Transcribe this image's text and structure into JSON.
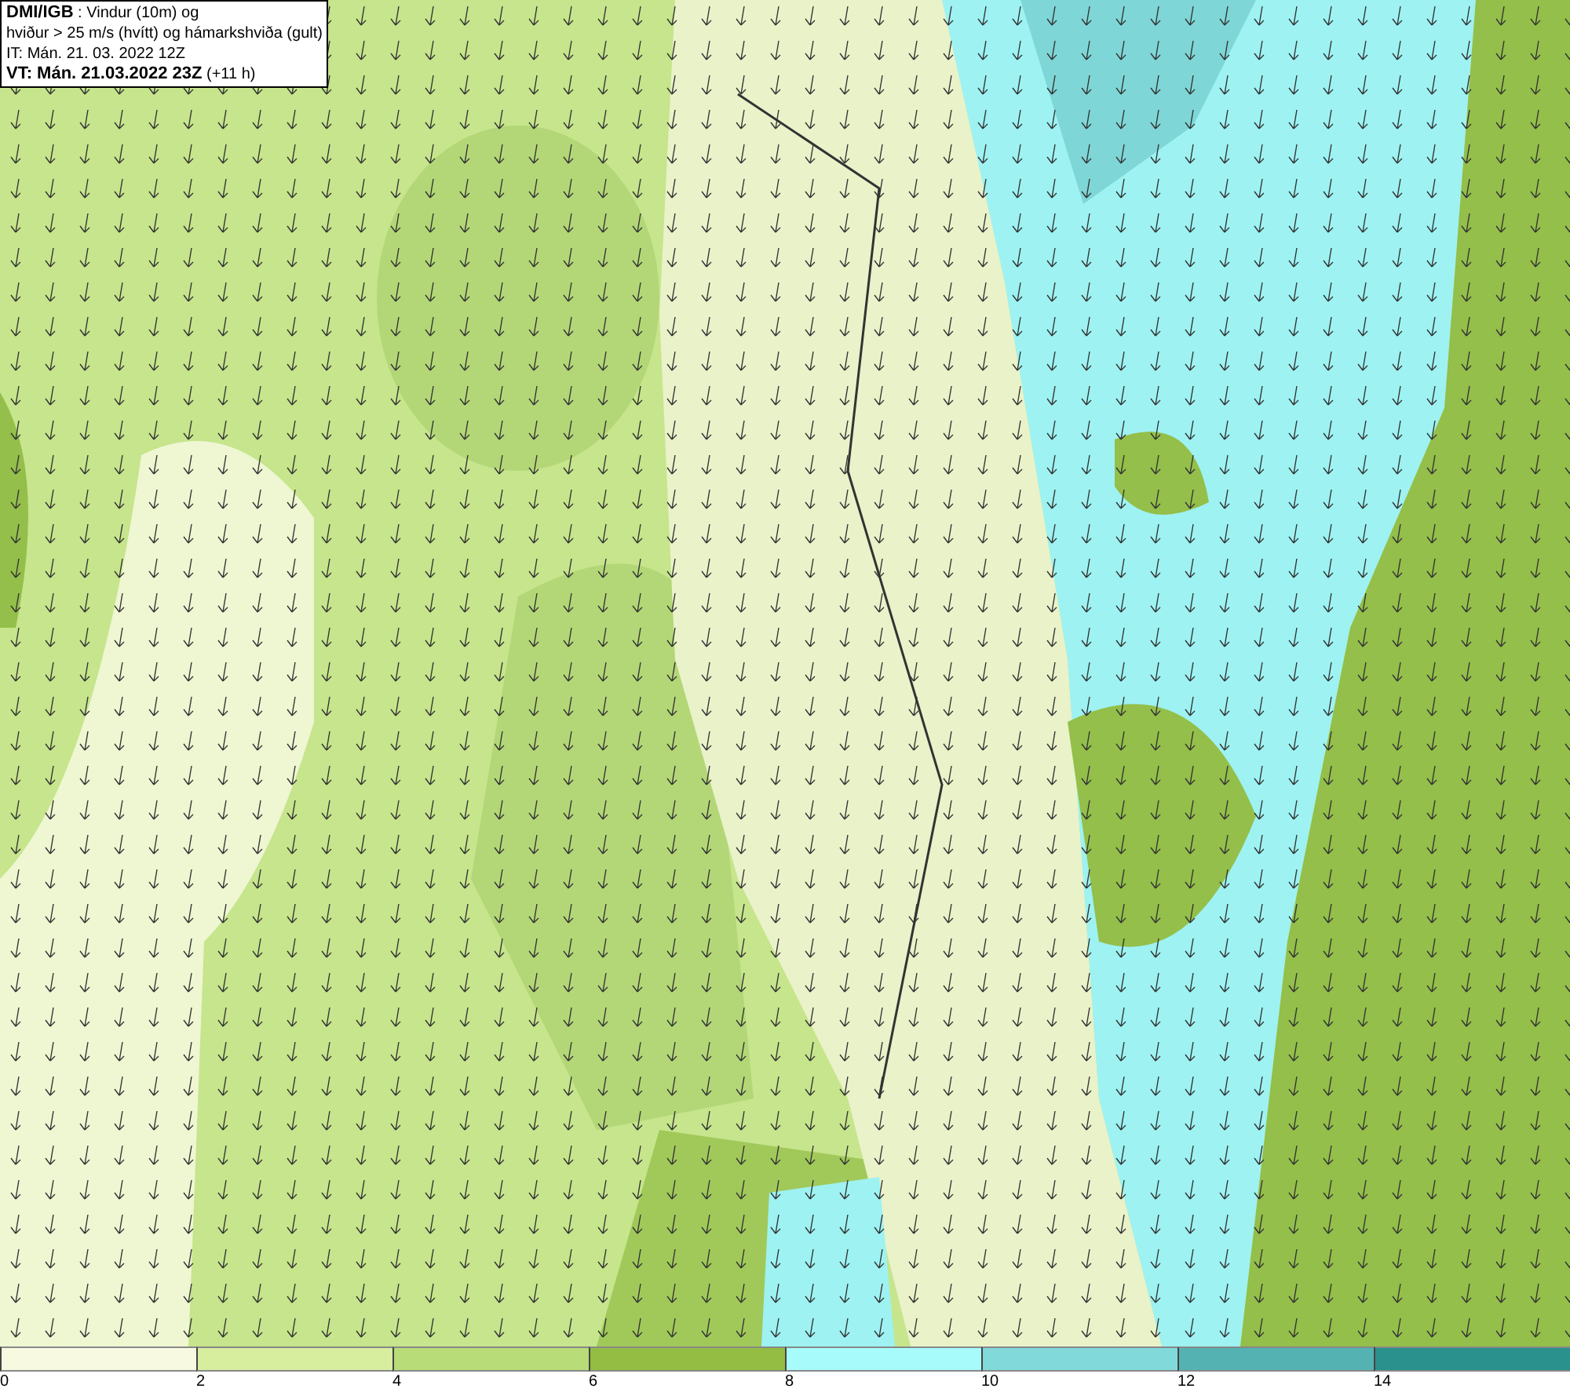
{
  "info_box": {
    "lines": [
      "**DMI/IGB** : Vindur (10m) og",
      "hviður > 25 m/s (hvítt) og hámarkshviða (gult)",
      "IT: Mán. 21. 03. 2022 12Z",
      "**VT: Mán. 21.03.2022 23Z** (+11 h)"
    ]
  },
  "legend": [
    {
      "label": "0",
      "color": "#f7f9e0"
    },
    {
      "label": "2",
      "color": "#d6ee9e"
    },
    {
      "label": "4",
      "color": "#b8dc78"
    },
    {
      "label": "6",
      "color": "#93bd43"
    },
    {
      "label": "8",
      "color": "#a8fbfb"
    },
    {
      "label": "10",
      "color": "#82d9d9"
    },
    {
      "label": "12",
      "color": "#55b2b2"
    },
    {
      "label": "14",
      "color": "#2a918c"
    }
  ]
}
